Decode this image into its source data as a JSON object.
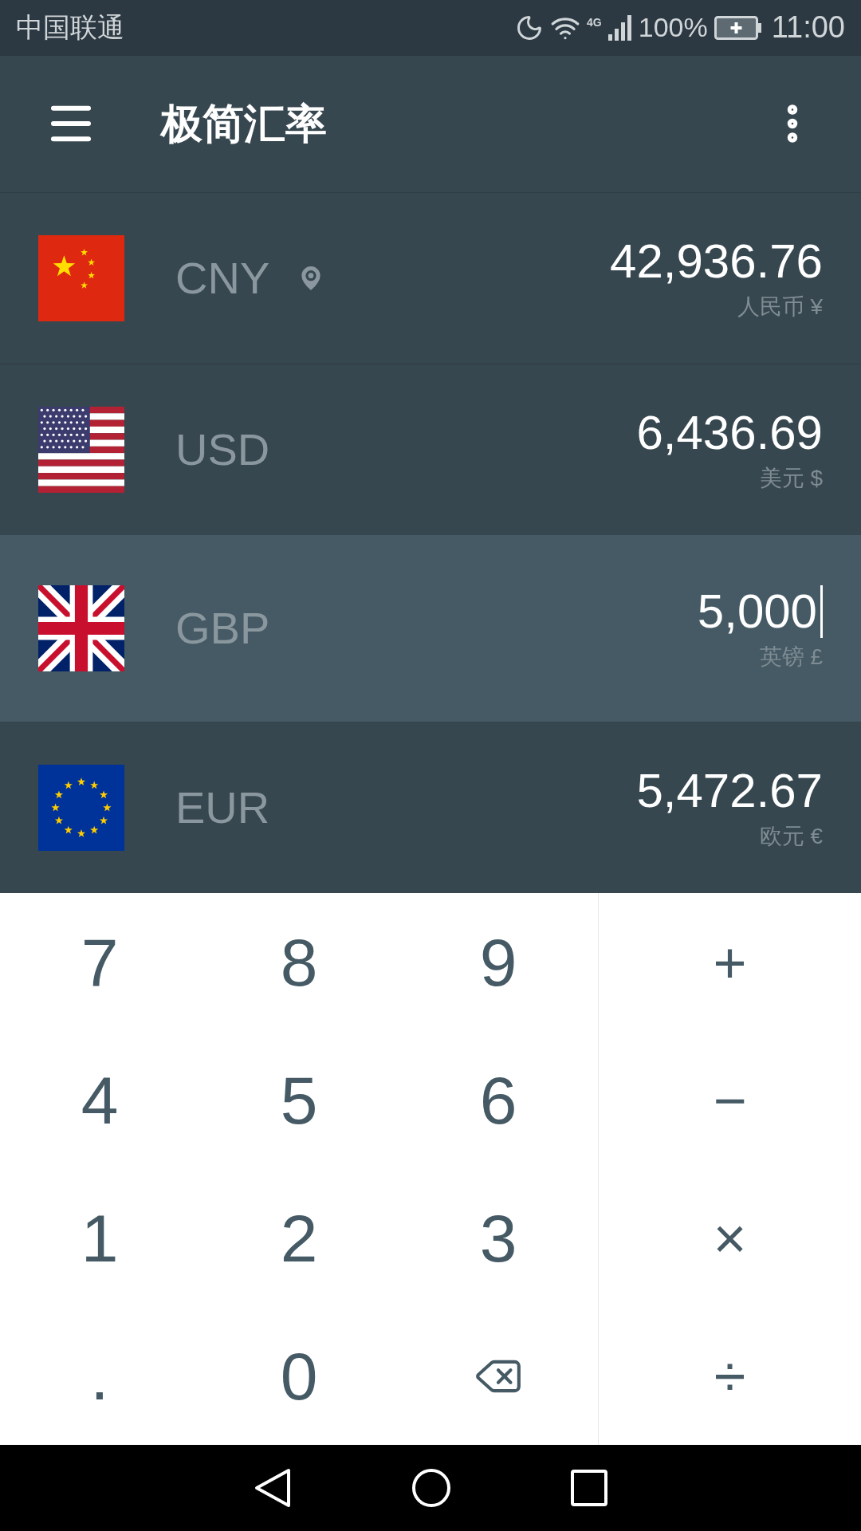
{
  "status_bar": {
    "carrier": "中国联通",
    "network": "4G",
    "battery": "100%",
    "time": "11:00"
  },
  "app_bar": {
    "title": "极简汇率"
  },
  "rows": [
    {
      "code": "CNY",
      "amount": "42,936.76",
      "name": "人民币 ¥",
      "located": true,
      "selected": false
    },
    {
      "code": "USD",
      "amount": "6,436.69",
      "name": "美元 $",
      "located": false,
      "selected": false
    },
    {
      "code": "GBP",
      "amount": "5,000",
      "name": "英镑 £",
      "located": false,
      "selected": true
    },
    {
      "code": "EUR",
      "amount": "5,472.67",
      "name": "欧元 €",
      "located": false,
      "selected": false
    }
  ],
  "keypad": [
    {
      "kind": "digit",
      "label": "7"
    },
    {
      "kind": "digit",
      "label": "8"
    },
    {
      "kind": "digit",
      "label": "9"
    },
    {
      "kind": "operator",
      "label": "+"
    },
    {
      "kind": "digit",
      "label": "4"
    },
    {
      "kind": "digit",
      "label": "5"
    },
    {
      "kind": "digit",
      "label": "6"
    },
    {
      "kind": "operator",
      "label": "−"
    },
    {
      "kind": "digit",
      "label": "1"
    },
    {
      "kind": "digit",
      "label": "2"
    },
    {
      "kind": "digit",
      "label": "3"
    },
    {
      "kind": "operator",
      "label": "×"
    },
    {
      "kind": "digit",
      "label": "."
    },
    {
      "kind": "digit",
      "label": "0"
    },
    {
      "kind": "backspace"
    },
    {
      "kind": "operator",
      "label": "÷"
    }
  ]
}
